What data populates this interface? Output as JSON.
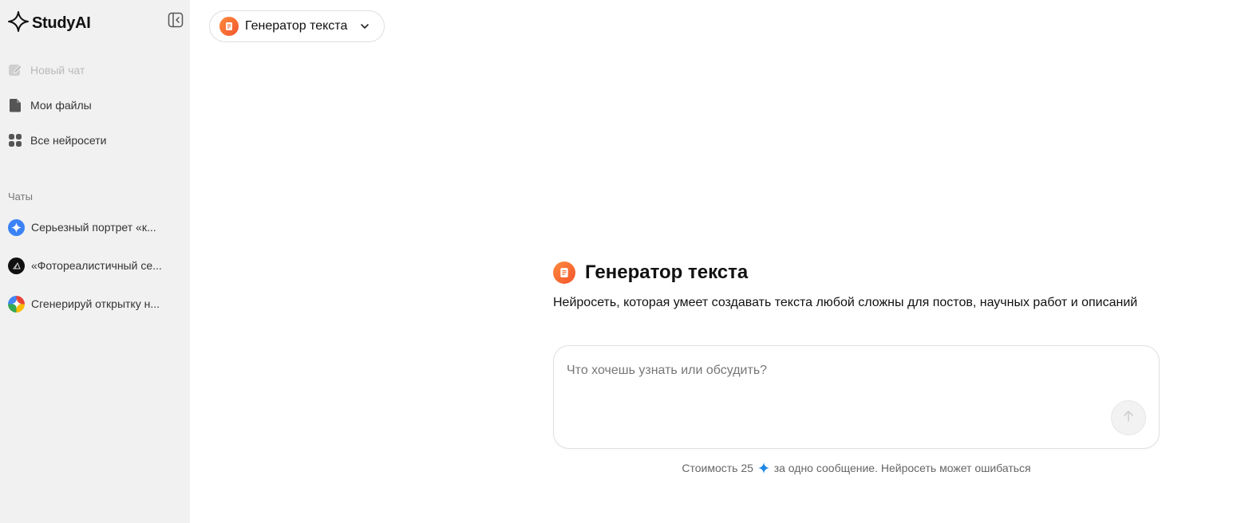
{
  "brand": {
    "name": "StudyAI",
    "logo_icon": "sparkle-icon"
  },
  "sidebar": {
    "collapse_icon": "sidebar-collapse-icon",
    "nav": [
      {
        "label": "Новый чат",
        "icon": "edit-icon",
        "enabled": false
      },
      {
        "label": "Мои файлы",
        "icon": "file-icon",
        "enabled": true
      },
      {
        "label": "Все нейросети",
        "icon": "grid-icon",
        "enabled": true
      }
    ],
    "chats_label": "Чаты",
    "chats": [
      {
        "label": "Серьезный портрет «к...",
        "avatar": "gemini-avatar",
        "color": "#3b82f6"
      },
      {
        "label": "«Фотореалистичный се...",
        "avatar": "midjourney-avatar",
        "color": "#111111"
      },
      {
        "label": "Сгенерируй открытку н...",
        "avatar": "multicolor-avatar",
        "color": "#4285f4"
      }
    ]
  },
  "model_selector": {
    "label": "Генератор текста",
    "icon": "text-generator-icon"
  },
  "hero": {
    "title": "Генератор текста",
    "description": "Нейросеть, которая умеет создавать текста любой сложны для постов, научных работ и описаний"
  },
  "composer": {
    "placeholder": "Что хочешь узнать или обсудить?",
    "value": "",
    "send_icon": "arrow-up-icon"
  },
  "footnote": {
    "before": "Стоимость 25",
    "after": "за одно сообщение. Нейросеть может ошибаться",
    "spark_color": "#1e88e5"
  },
  "colors": {
    "accent_orange": "#f26b2c",
    "sidebar_bg": "#f1f1f1"
  }
}
